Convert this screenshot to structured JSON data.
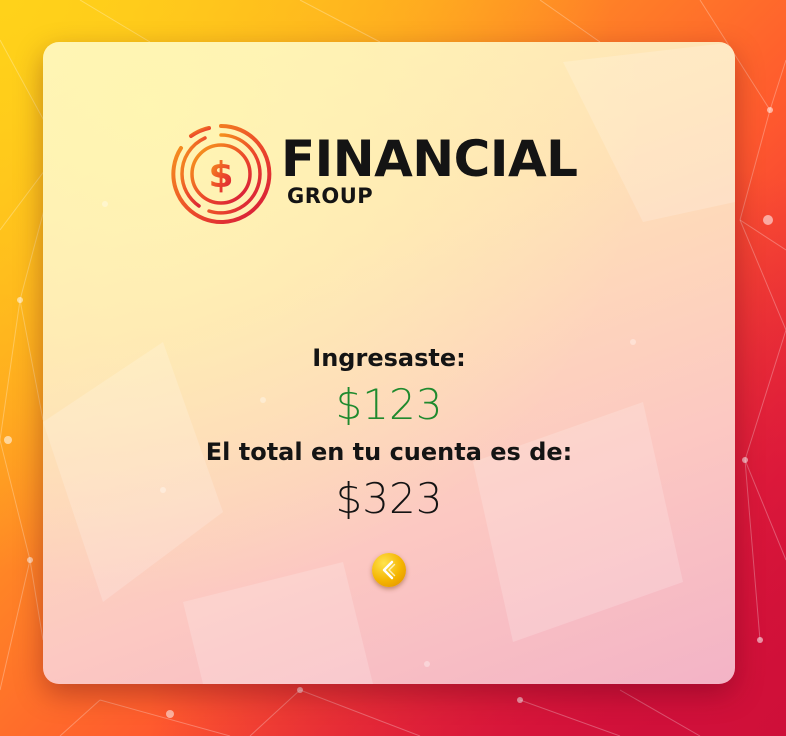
{
  "brand": {
    "name": "FINANCIAL",
    "subtitle": "GROUP",
    "logo_icon": "dollar-coin-icon"
  },
  "summary": {
    "deposit_label": "Ingresaste:",
    "deposit_amount": "$123",
    "total_label": "El total en tu cuenta es de:",
    "total_amount": "$323"
  },
  "actions": {
    "back_icon": "chevron-left-icon"
  },
  "colors": {
    "deposit_amount": "#1f8a2e",
    "back_button": "#f4b400",
    "text": "#141414"
  }
}
